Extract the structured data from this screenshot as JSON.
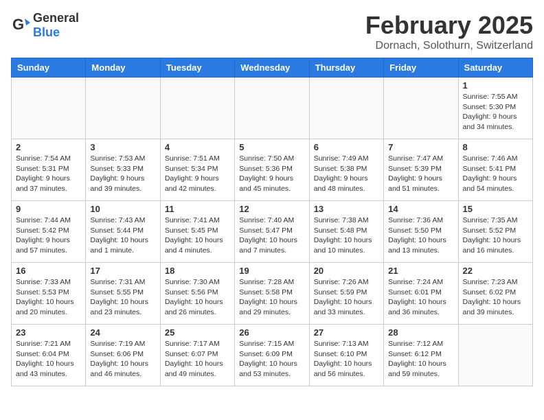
{
  "header": {
    "logo_general": "General",
    "logo_blue": "Blue",
    "title": "February 2025",
    "location": "Dornach, Solothurn, Switzerland"
  },
  "days_of_week": [
    "Sunday",
    "Monday",
    "Tuesday",
    "Wednesday",
    "Thursday",
    "Friday",
    "Saturday"
  ],
  "weeks": [
    [
      {
        "day": "",
        "info": ""
      },
      {
        "day": "",
        "info": ""
      },
      {
        "day": "",
        "info": ""
      },
      {
        "day": "",
        "info": ""
      },
      {
        "day": "",
        "info": ""
      },
      {
        "day": "",
        "info": ""
      },
      {
        "day": "1",
        "info": "Sunrise: 7:55 AM\nSunset: 5:30 PM\nDaylight: 9 hours and 34 minutes."
      }
    ],
    [
      {
        "day": "2",
        "info": "Sunrise: 7:54 AM\nSunset: 5:31 PM\nDaylight: 9 hours and 37 minutes."
      },
      {
        "day": "3",
        "info": "Sunrise: 7:53 AM\nSunset: 5:33 PM\nDaylight: 9 hours and 39 minutes."
      },
      {
        "day": "4",
        "info": "Sunrise: 7:51 AM\nSunset: 5:34 PM\nDaylight: 9 hours and 42 minutes."
      },
      {
        "day": "5",
        "info": "Sunrise: 7:50 AM\nSunset: 5:36 PM\nDaylight: 9 hours and 45 minutes."
      },
      {
        "day": "6",
        "info": "Sunrise: 7:49 AM\nSunset: 5:38 PM\nDaylight: 9 hours and 48 minutes."
      },
      {
        "day": "7",
        "info": "Sunrise: 7:47 AM\nSunset: 5:39 PM\nDaylight: 9 hours and 51 minutes."
      },
      {
        "day": "8",
        "info": "Sunrise: 7:46 AM\nSunset: 5:41 PM\nDaylight: 9 hours and 54 minutes."
      }
    ],
    [
      {
        "day": "9",
        "info": "Sunrise: 7:44 AM\nSunset: 5:42 PM\nDaylight: 9 hours and 57 minutes."
      },
      {
        "day": "10",
        "info": "Sunrise: 7:43 AM\nSunset: 5:44 PM\nDaylight: 10 hours and 1 minute."
      },
      {
        "day": "11",
        "info": "Sunrise: 7:41 AM\nSunset: 5:45 PM\nDaylight: 10 hours and 4 minutes."
      },
      {
        "day": "12",
        "info": "Sunrise: 7:40 AM\nSunset: 5:47 PM\nDaylight: 10 hours and 7 minutes."
      },
      {
        "day": "13",
        "info": "Sunrise: 7:38 AM\nSunset: 5:48 PM\nDaylight: 10 hours and 10 minutes."
      },
      {
        "day": "14",
        "info": "Sunrise: 7:36 AM\nSunset: 5:50 PM\nDaylight: 10 hours and 13 minutes."
      },
      {
        "day": "15",
        "info": "Sunrise: 7:35 AM\nSunset: 5:52 PM\nDaylight: 10 hours and 16 minutes."
      }
    ],
    [
      {
        "day": "16",
        "info": "Sunrise: 7:33 AM\nSunset: 5:53 PM\nDaylight: 10 hours and 20 minutes."
      },
      {
        "day": "17",
        "info": "Sunrise: 7:31 AM\nSunset: 5:55 PM\nDaylight: 10 hours and 23 minutes."
      },
      {
        "day": "18",
        "info": "Sunrise: 7:30 AM\nSunset: 5:56 PM\nDaylight: 10 hours and 26 minutes."
      },
      {
        "day": "19",
        "info": "Sunrise: 7:28 AM\nSunset: 5:58 PM\nDaylight: 10 hours and 29 minutes."
      },
      {
        "day": "20",
        "info": "Sunrise: 7:26 AM\nSunset: 5:59 PM\nDaylight: 10 hours and 33 minutes."
      },
      {
        "day": "21",
        "info": "Sunrise: 7:24 AM\nSunset: 6:01 PM\nDaylight: 10 hours and 36 minutes."
      },
      {
        "day": "22",
        "info": "Sunrise: 7:23 AM\nSunset: 6:02 PM\nDaylight: 10 hours and 39 minutes."
      }
    ],
    [
      {
        "day": "23",
        "info": "Sunrise: 7:21 AM\nSunset: 6:04 PM\nDaylight: 10 hours and 43 minutes."
      },
      {
        "day": "24",
        "info": "Sunrise: 7:19 AM\nSunset: 6:06 PM\nDaylight: 10 hours and 46 minutes."
      },
      {
        "day": "25",
        "info": "Sunrise: 7:17 AM\nSunset: 6:07 PM\nDaylight: 10 hours and 49 minutes."
      },
      {
        "day": "26",
        "info": "Sunrise: 7:15 AM\nSunset: 6:09 PM\nDaylight: 10 hours and 53 minutes."
      },
      {
        "day": "27",
        "info": "Sunrise: 7:13 AM\nSunset: 6:10 PM\nDaylight: 10 hours and 56 minutes."
      },
      {
        "day": "28",
        "info": "Sunrise: 7:12 AM\nSunset: 6:12 PM\nDaylight: 10 hours and 59 minutes."
      },
      {
        "day": "",
        "info": ""
      }
    ]
  ]
}
